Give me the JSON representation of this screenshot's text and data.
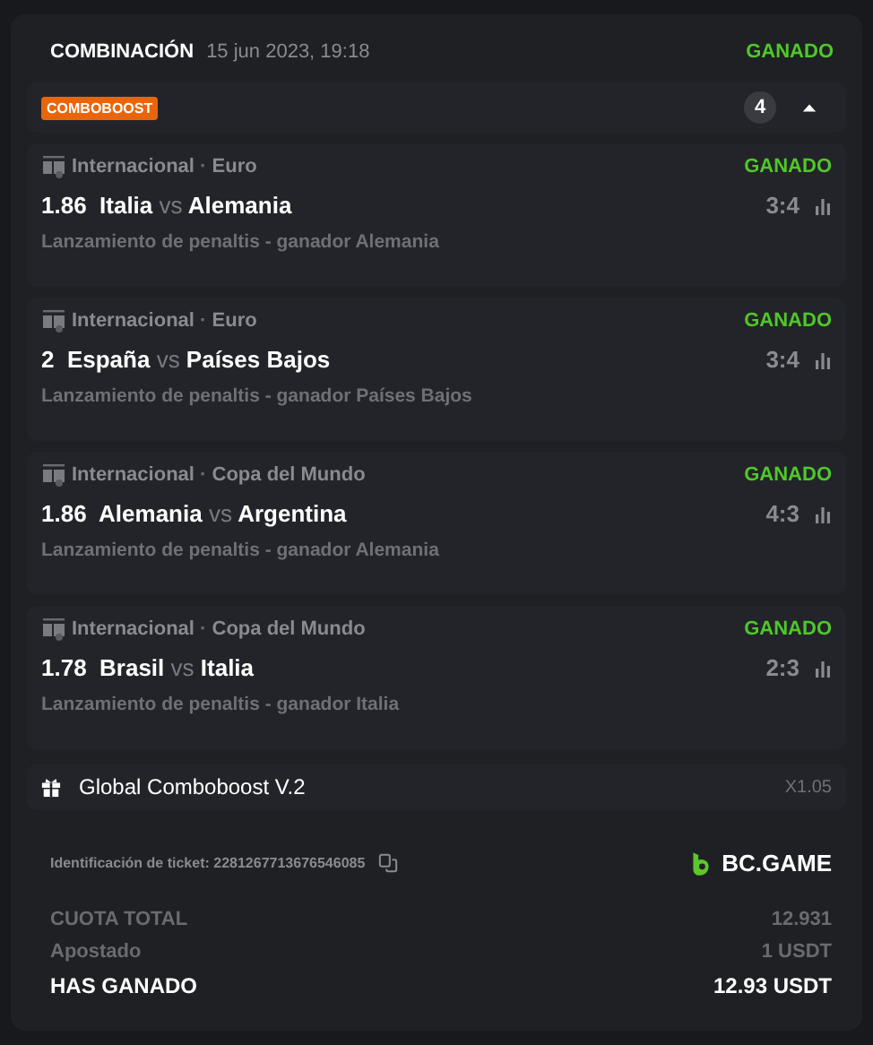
{
  "header": {
    "title": "COMBINACIÓN",
    "date": "15 jun 2023, 19:18",
    "status": "GANADO"
  },
  "boost_bar": {
    "badge": "COMBOBOOST",
    "count": "4",
    "expanded": true
  },
  "legs": [
    {
      "league": "Internacional",
      "separator": "·",
      "competition": "Euro",
      "status": "GANADO",
      "odds": "1.86",
      "home": "Italia",
      "vs": "vs",
      "away": "Alemania",
      "score": "3:4",
      "market": "Lanzamiento de penaltis - ganador Alemania"
    },
    {
      "league": "Internacional",
      "separator": "·",
      "competition": "Euro",
      "status": "GANADO",
      "odds": "2",
      "home": "España",
      "vs": "vs",
      "away": "Países Bajos",
      "score": "3:4",
      "market": "Lanzamiento de penaltis - ganador Países Bajos"
    },
    {
      "league": "Internacional",
      "separator": "·",
      "competition": "Copa del Mundo",
      "status": "GANADO",
      "odds": "1.86",
      "home": "Alemania",
      "vs": "vs",
      "away": "Argentina",
      "score": "4:3",
      "market": "Lanzamiento de penaltis - ganador Alemania"
    },
    {
      "league": "Internacional",
      "separator": "·",
      "competition": "Copa del Mundo",
      "status": "GANADO",
      "odds": "1.78",
      "home": "Brasil",
      "vs": "vs",
      "away": "Italia",
      "score": "2:3",
      "market": "Lanzamiento de penaltis - ganador Italia"
    }
  ],
  "boost": {
    "name": "Global Comboboost V.2",
    "multiplier": "X1.05"
  },
  "ticket": {
    "label": "Identificación de ticket: 2281267713676546085",
    "brand": "BC.GAME"
  },
  "totals": [
    {
      "label": "CUOTA TOTAL",
      "value": "12.931",
      "kind": "muted"
    },
    {
      "label": "Apostado",
      "value": "1 USDT",
      "kind": "muted"
    },
    {
      "label": "HAS GANADO",
      "value": "12.93 USDT",
      "kind": "strong"
    }
  ]
}
